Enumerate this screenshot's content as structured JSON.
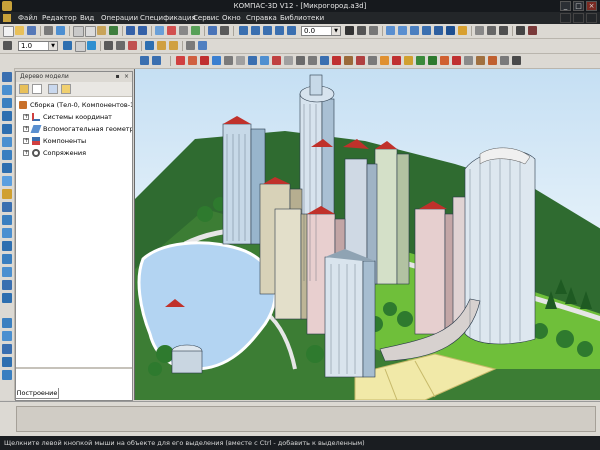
{
  "window": {
    "title": "КОМПАС-3D V12 - [Микрогород.a3d]",
    "minimize": "_",
    "maximize": "□",
    "close": "×"
  },
  "menu": [
    "Файл",
    "Редактор",
    "Вид",
    "Операции",
    "Спецификация",
    "Сервис",
    "Окно",
    "Справка",
    "Библиотеки"
  ],
  "toolbar": {
    "scale_value": "1.0",
    "step_value": "0.0"
  },
  "tree": {
    "title": "Дерево модели",
    "root": "Сборка (Тел-0, Компонентов-14",
    "items": [
      "Системы координат",
      "Вспомогательная геометр",
      "Компоненты",
      "Сопряжения"
    ],
    "tab_label": "Построение"
  },
  "status": {
    "hint": "Щелкните левой кнопкой мыши на объекте для его выделения (вместе с Ctrl - добавить к выделенным)"
  },
  "colors": {
    "titlebar": "#16191d",
    "menubar": "#232629",
    "grass": "#2f6b30",
    "water": "#b3d4f2",
    "roof_red": "#c0312b"
  }
}
